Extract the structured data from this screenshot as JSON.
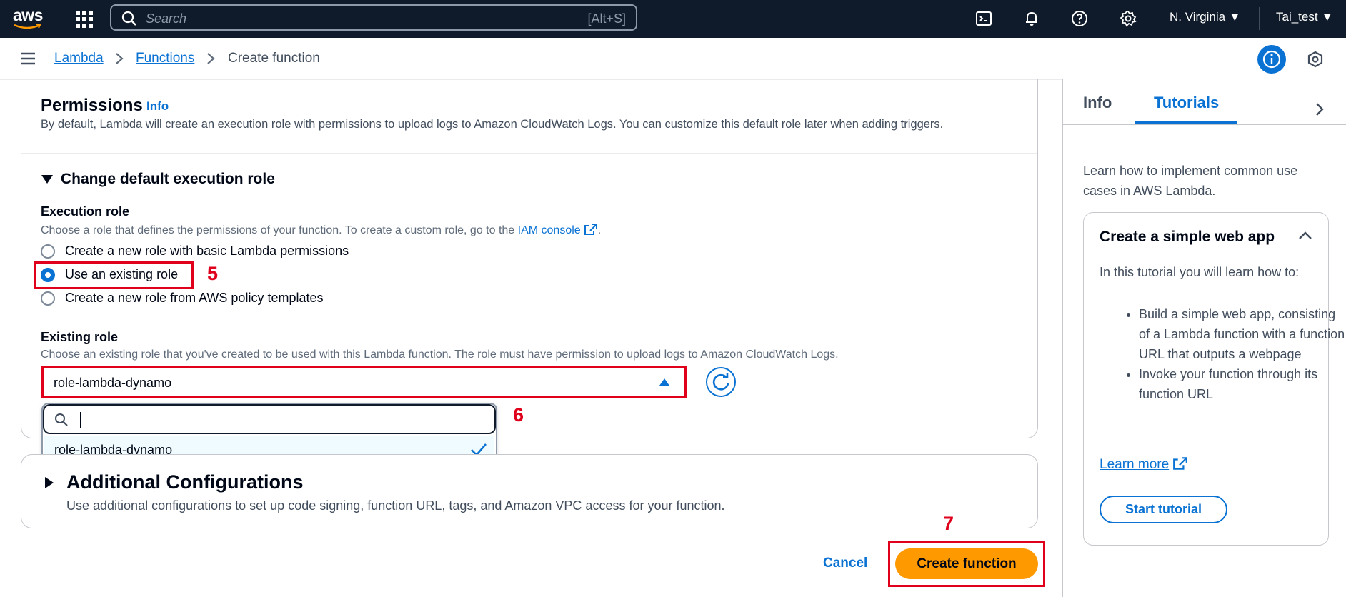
{
  "topnav": {
    "logo": "aws",
    "search_placeholder": "Search",
    "search_shortcut": "[Alt+S]",
    "region": "N. Virginia",
    "user": "Tai_test"
  },
  "breadcrumb": {
    "items": [
      "Lambda",
      "Functions",
      "Create function"
    ]
  },
  "permissions": {
    "title": "Permissions",
    "info": "Info",
    "description": "By default, Lambda will create an execution role with permissions to upload logs to Amazon CloudWatch Logs. You can customize this default role later when adding triggers."
  },
  "execution_role_section": {
    "toggle_label": "Change default execution role",
    "label": "Execution role",
    "description": "Choose a role that defines the permissions of your function. To create a custom role, go to the",
    "link": "IAM console",
    "options": [
      "Create a new role with basic Lambda permissions",
      "Use an existing role",
      "Create a new role from AWS policy templates"
    ],
    "selected_index": 1
  },
  "existing_role": {
    "label": "Existing role",
    "description": "Choose an existing role that you've created to be used with this Lambda function. The role must have permission to upload logs to Amazon CloudWatch Logs.",
    "value": "role-lambda-dynamo",
    "dropdown_options": [
      "role-lambda-dynamo"
    ]
  },
  "annotations": [
    "5",
    "6",
    "7"
  ],
  "additional_config": {
    "title": "Additional Configurations",
    "description": "Use additional configurations to set up code signing, function URL, tags, and Amazon VPC access for your function."
  },
  "actions": {
    "cancel": "Cancel",
    "create": "Create function"
  },
  "side_panel": {
    "tabs": [
      "Info",
      "Tutorials"
    ],
    "active_tab": "Tutorials",
    "intro": "Learn how to implement common use cases in AWS Lambda.",
    "tutorial": {
      "title": "Create a simple web app",
      "body": "In this tutorial you will learn how to:",
      "steps": [
        "Build a simple web app, consisting of a Lambda function with a function URL that outputs a webpage",
        "Invoke your function through its function URL"
      ],
      "learn_more": "Learn more",
      "start": "Start tutorial"
    }
  },
  "colors": {
    "nav_bg": "#0f1b2a",
    "accent": "#0972d3",
    "primary_button": "#ff9900",
    "annotation_red": "#e0001b"
  }
}
